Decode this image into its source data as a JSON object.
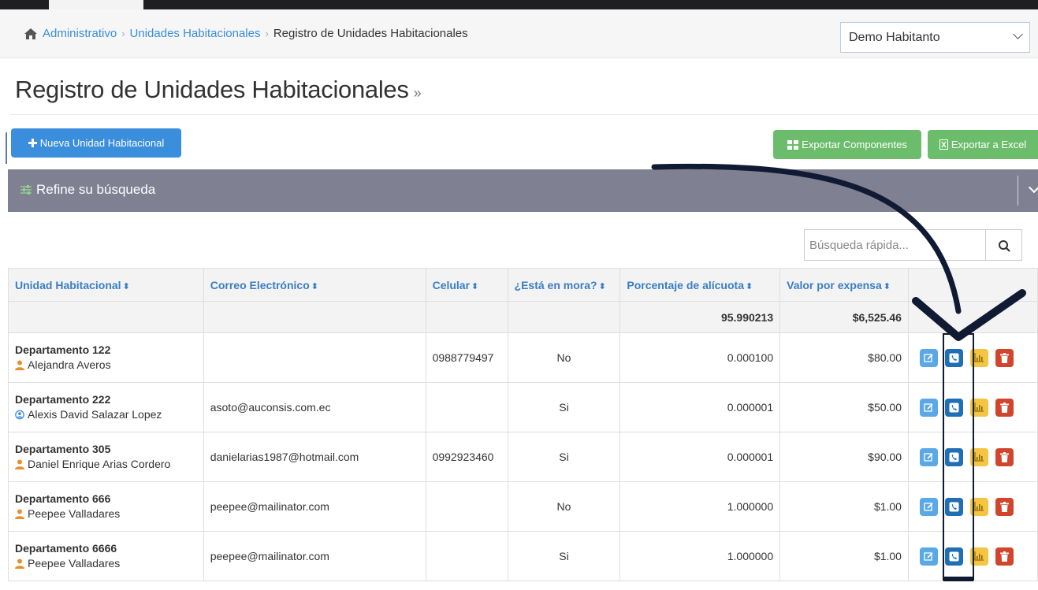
{
  "breadcrumb": {
    "items": [
      "Administrativo",
      "Unidades Habitacionales"
    ],
    "current": "Registro de Unidades Habitacionales"
  },
  "community_select": {
    "value": "Demo Habitanto"
  },
  "page_title": "Registro de Unidades Habitacionales",
  "page_title_suffix": "»",
  "buttons": {
    "new_unit": "Nueva Unidad Habitacional",
    "export_components": "Exportar Componentes",
    "export_excel": "Exportar a Excel"
  },
  "refine": {
    "label": "Refine su búsqueda"
  },
  "search": {
    "placeholder": "Búsqueda rápida..."
  },
  "table": {
    "headers": [
      "Unidad Habitacional",
      "Correo Electrónico",
      "Celular",
      "¿Está en mora?",
      "Porcentaje de alícuota",
      "Valor por expensa"
    ],
    "sort_glyph": "⬍",
    "totals": {
      "alicuota": "95.990213",
      "expensa": "$6,525.46"
    },
    "rows": [
      {
        "unit": "Departamento 122",
        "owner": "Alejandra Averos",
        "owner_type": "person",
        "email": "",
        "phone": "0988779497",
        "mora": "No",
        "alicuota": "0.000100",
        "expensa": "$80.00"
      },
      {
        "unit": "Departamento 222",
        "owner": "Alexis David Salazar Lopez",
        "owner_type": "user",
        "email": "asoto@auconsis.com.ec",
        "phone": "",
        "mora": "Si",
        "alicuota": "0.000001",
        "expensa": "$50.00"
      },
      {
        "unit": "Departamento 305",
        "owner": "Daniel Enrique Arias Cordero",
        "owner_type": "person",
        "email": "danielarias1987@hotmail.com",
        "phone": "0992923460",
        "mora": "Si",
        "alicuota": "0.000001",
        "expensa": "$90.00"
      },
      {
        "unit": "Departamento 666",
        "owner": "Peepee Valladares",
        "owner_type": "person",
        "email": "peepee@mailinator.com",
        "phone": "",
        "mora": "No",
        "alicuota": "1.000000",
        "expensa": "$1.00"
      },
      {
        "unit": "Departamento 6666",
        "owner": "Peepee Valladares",
        "owner_type": "person",
        "email": "peepee@mailinator.com",
        "phone": "",
        "mora": "Si",
        "alicuota": "1.000000",
        "expensa": "$1.00"
      }
    ]
  },
  "colors": {
    "primary": "#3a8edb",
    "success": "#6bbd6b",
    "refine_bar": "#808093",
    "link": "#3a7ec4",
    "action_edit": "#5aa9e6",
    "action_phone": "#1f6fb5",
    "action_chart": "#f4c542",
    "action_delete": "#d2452d",
    "annotation": "#111a33"
  }
}
